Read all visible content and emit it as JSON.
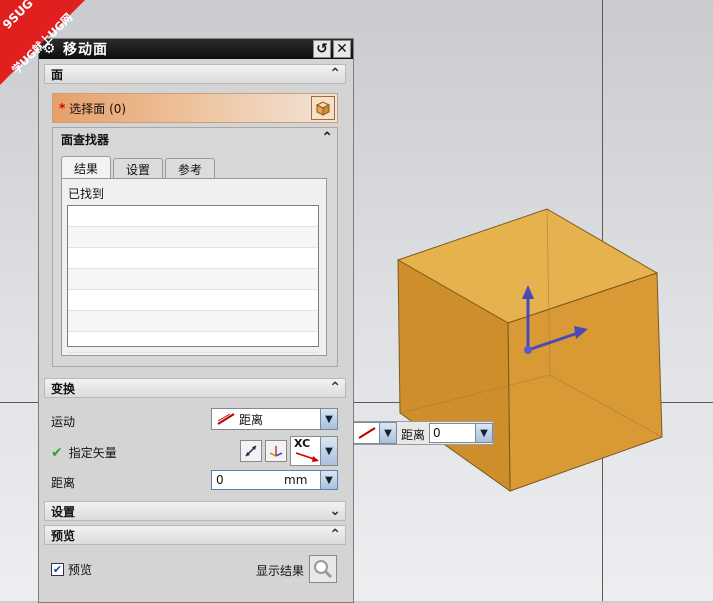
{
  "watermark": {
    "line1": "9SUG",
    "line2": "学UG就上UG网"
  },
  "dialog": {
    "title": "移动面",
    "face_section": {
      "header": "面",
      "select_label": "选择面 (0)",
      "finder": {
        "header": "面查找器",
        "tabs": [
          "结果",
          "设置",
          "参考"
        ],
        "found_label": "已找到"
      }
    },
    "transform_section": {
      "header": "变换",
      "motion_label": "运动",
      "motion_value": "距离",
      "vector_label": "指定矢量",
      "vector_option": "XC",
      "distance_label": "距离",
      "distance_value": "0",
      "distance_unit": "mm"
    },
    "settings_section": {
      "header": "设置"
    },
    "preview_section": {
      "header": "预览",
      "preview_checkbox": "预览",
      "preview_checked": true,
      "show_result_label": "显示结果"
    }
  },
  "floating_input": {
    "label": "距离",
    "value": "0"
  },
  "colors": {
    "cube_face": "#e2a43a",
    "accent_red": "#e01f1f",
    "title_bg": "#111111"
  },
  "icons": [
    "gear-icon",
    "reset-icon",
    "close-icon",
    "chevron-up-icon",
    "chevron-down-icon",
    "cube-icon",
    "vector-dialog-icon",
    "reverse-direction-icon",
    "magnifier-icon",
    "checkmark-icon"
  ]
}
